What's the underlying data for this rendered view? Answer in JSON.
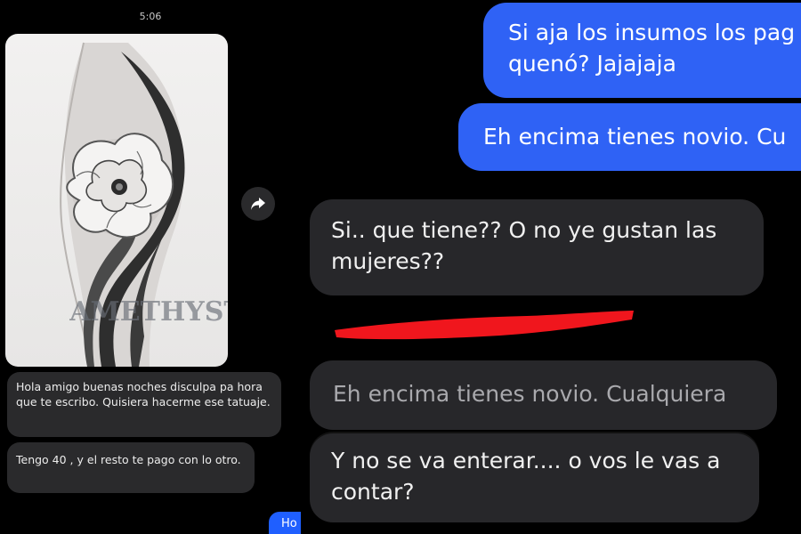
{
  "left": {
    "time": "5:06",
    "image": {
      "alt_icon": "tattoo-image",
      "watermark": "AMETHYST"
    },
    "messages": [
      "Hola amigo buenas noches disculpa pa hora que te escribo. Quisiera hacerme ese tatuaje.",
      "Tengo 40 , y el resto te pago con lo otro."
    ],
    "partial_outgoing": "Ho"
  },
  "right": {
    "outgoing": [
      "Si aja los insumos los pag",
      "quenó?  Jajajaja",
      "Eh encima tienes novio. Cu"
    ],
    "incoming": [
      "Si.. que tiene?? O no ye gustan las",
      "mujeres??"
    ],
    "faded_quote": "Eh encima tienes novio. Cualquiera",
    "reply": [
      "Y no se va enterar.... o vos le vas a",
      "contar?"
    ]
  },
  "colors": {
    "outgoing_blue": "#2f62f5",
    "incoming_gray": "#27272a",
    "redact_red": "#f0161d"
  }
}
